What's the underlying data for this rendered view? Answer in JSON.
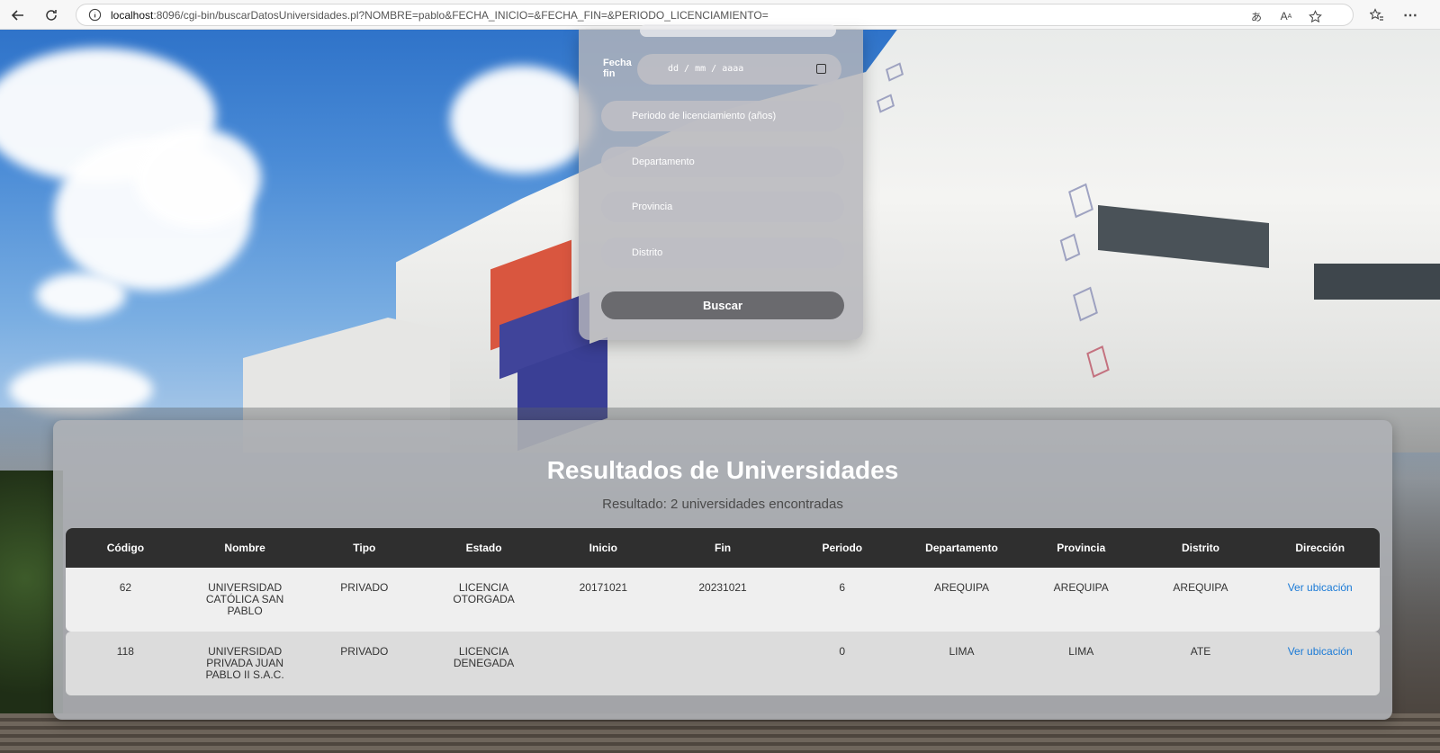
{
  "browser": {
    "url_host": "localhost",
    "url_rest": ":8096/cgi-bin/buscarDatosUniversidades.pl?NOMBRE=pablo&FECHA_INICIO=&FECHA_FIN=&PERIODO_LICENCIAMIENTO="
  },
  "form": {
    "fecha_fin_label": "Fecha fin",
    "date_placeholder": "dd / mm / aaaa",
    "periodo_placeholder": "Periodo de licenciamiento (años)",
    "departamento_placeholder": "Departamento",
    "provincia_placeholder": "Provincia",
    "distrito_placeholder": "Distrito",
    "buscar_label": "Buscar"
  },
  "results": {
    "title": "Resultados de Universidades",
    "subtitle": "Resultado: 2 universidades encontradas",
    "headers": [
      "Código",
      "Nombre",
      "Tipo",
      "Estado",
      "Inicio",
      "Fin",
      "Periodo",
      "Departamento",
      "Provincia",
      "Distrito",
      "Dirección"
    ],
    "rows": [
      {
        "codigo": "62",
        "nombre": "UNIVERSIDAD CATÓLICA SAN PABLO",
        "tipo": "PRIVADO",
        "estado": "LICENCIA OTORGADA",
        "inicio": "20171021",
        "fin": "20231021",
        "periodo": "6",
        "departamento": "AREQUIPA",
        "provincia": "AREQUIPA",
        "distrito": "AREQUIPA",
        "direccion": "Ver ubicación"
      },
      {
        "codigo": "118",
        "nombre": "UNIVERSIDAD PRIVADA JUAN PABLO II S.A.C.",
        "tipo": "PRIVADO",
        "estado": "LICENCIA DENEGADA",
        "inicio": "",
        "fin": "",
        "periodo": "0",
        "departamento": "LIMA",
        "provincia": "LIMA",
        "distrito": "ATE",
        "direccion": "Ver ubicación"
      }
    ]
  },
  "colors": {
    "header_bg": "#2f2f2f",
    "link": "#1a7ad6",
    "button_bg": "#6a6a6e"
  }
}
